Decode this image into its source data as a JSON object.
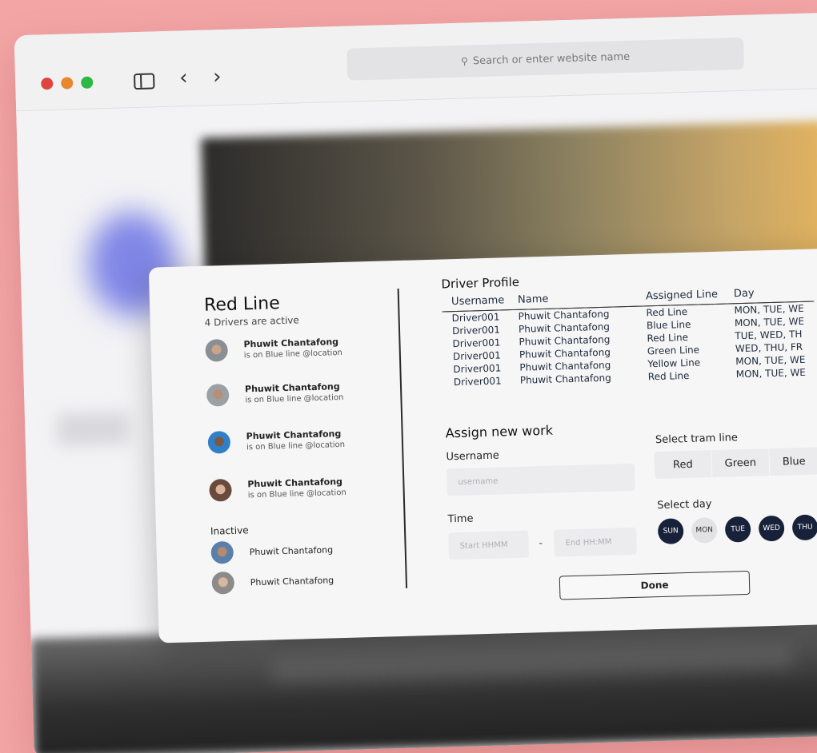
{
  "browser": {
    "address_placeholder": "Search or enter website name"
  },
  "left_panel": {
    "title": "Red Line",
    "active_count": "4 Drivers are active",
    "active_drivers": [
      {
        "name": "Phuwit Chantafong",
        "status": "is on Blue line @location"
      },
      {
        "name": "Phuwit Chantafong",
        "status": "is on Blue line @location"
      },
      {
        "name": "Phuwit Chantafong",
        "status": "is on Blue line @location"
      },
      {
        "name": "Phuwit Chantafong",
        "status": "is on Blue line @location"
      }
    ],
    "inactive_label": "Inactive",
    "inactive_drivers": [
      {
        "name": "Phuwit Chantafong"
      },
      {
        "name": "Phuwit Chantafong"
      }
    ]
  },
  "driver_profile": {
    "title": "Driver Profile",
    "columns": [
      "Username",
      "Name",
      "Assigned Line",
      "Day"
    ],
    "rows": [
      [
        "Driver001",
        "Phuwit Chantafong",
        "Red Line",
        "MON, TUE, WE"
      ],
      [
        "Driver001",
        "Phuwit Chantafong",
        "Blue Line",
        "MON, TUE, WE"
      ],
      [
        "Driver001",
        "Phuwit Chantafong",
        "Red Line",
        "TUE, WED, TH"
      ],
      [
        "Driver001",
        "Phuwit Chantafong",
        "Green Line",
        "WED, THU, FR"
      ],
      [
        "Driver001",
        "Phuwit Chantafong",
        "Yellow Line",
        "MON, TUE, WE"
      ],
      [
        "Driver001",
        "Phuwit Chantafong",
        "Red Line",
        "MON, TUE, WE"
      ]
    ]
  },
  "assign": {
    "title": "Assign new work",
    "username_label": "Username",
    "username_placeholder": "username",
    "time_label": "Time",
    "start_placeholder": "Start HHMM",
    "dash": "-",
    "end_placeholder": "End HH:MM",
    "tram_label": "Select tram line",
    "tram_options": [
      "Red",
      "Green",
      "Blue"
    ],
    "day_label": "Select day",
    "days": [
      {
        "label": "SUN",
        "selected": true
      },
      {
        "label": "MON",
        "selected": false
      },
      {
        "label": "TUE",
        "selected": true
      },
      {
        "label": "WED",
        "selected": true
      },
      {
        "label": "THU",
        "selected": true
      }
    ],
    "done_label": "Done"
  },
  "colors": {
    "background": "#f3a5a5",
    "accent_dark": "#17213a",
    "traffic_red": "#e0443e",
    "traffic_yellow": "#e8872e",
    "traffic_green": "#2db744"
  }
}
